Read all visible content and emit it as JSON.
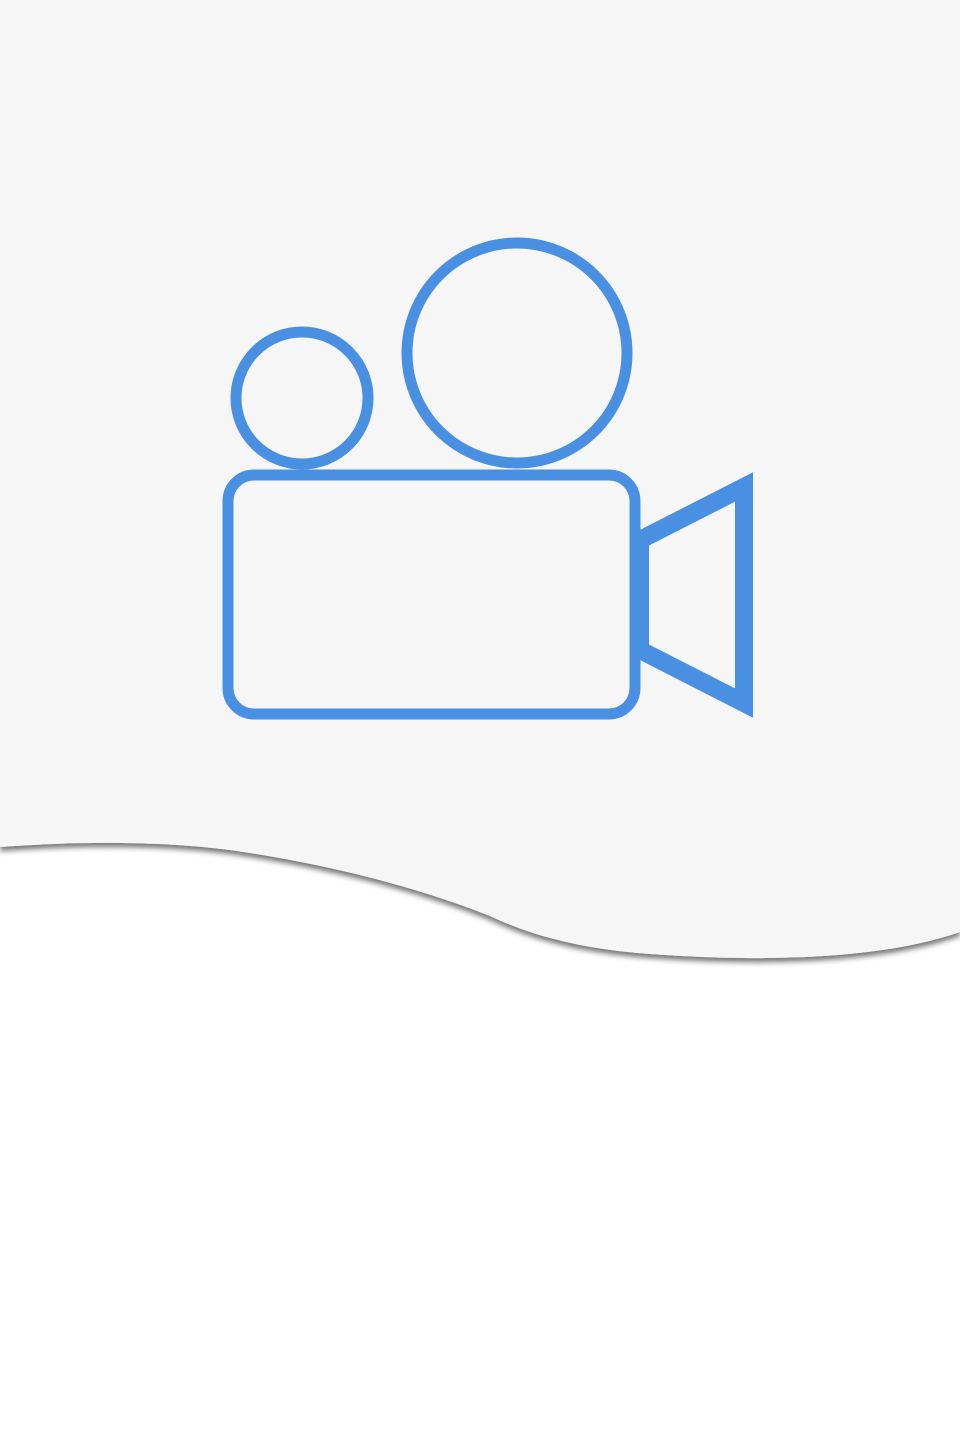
{
  "screen": {
    "background_color": "#ffffff",
    "hero_background_color": "#f6f6f6",
    "accent_color": "#4a90e2",
    "hero_icon": "video-camera-icon"
  }
}
